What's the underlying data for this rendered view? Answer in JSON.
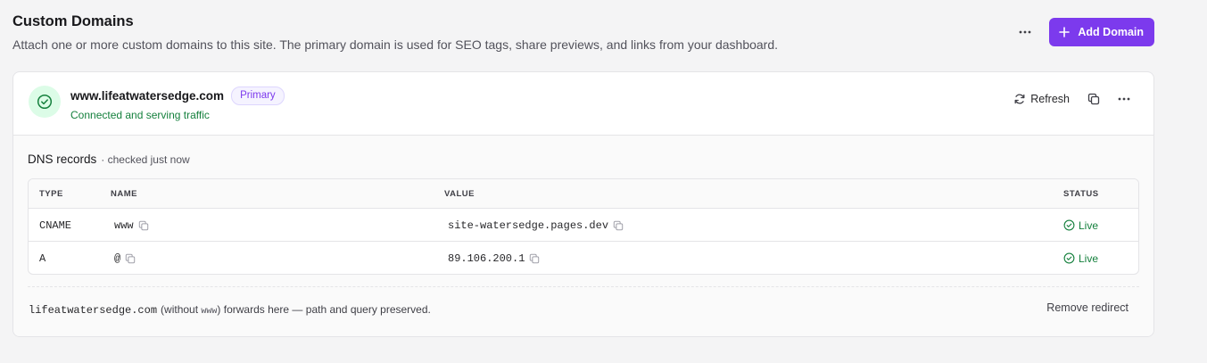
{
  "header": {
    "title": "Custom Domains",
    "description": "Attach one or more custom domains to this site. The primary domain is used for SEO tags, share previews, and links from your dashboard.",
    "more_icon": "more-horizontal-icon",
    "add_button_label": "Add Domain",
    "add_icon": "plus-icon"
  },
  "domain": {
    "name": "www.lifeatwatersedge.com",
    "badge": "Primary",
    "status_text": "Connected and serving traffic",
    "status_icon": "check-circle-icon",
    "refresh_label": "Refresh",
    "copy_icon": "copy-icon",
    "more_icon": "more-horizontal-icon"
  },
  "dns": {
    "title": "DNS records",
    "checked": "· checked just now",
    "columns": [
      "TYPE",
      "NAME",
      "VALUE",
      "STATUS"
    ],
    "rows": [
      {
        "type": "CNAME",
        "name": "www",
        "value": "site-watersedge.pages.dev",
        "status": "Live"
      },
      {
        "type": "A",
        "name": "@",
        "value": "89.106.200.1",
        "status": "Live"
      }
    ]
  },
  "redirect": {
    "domain": "lifeatwatersedge.com",
    "without_prefix": "(without ",
    "without_code": "www",
    "suffix": ") forwards here — path and query preserved.",
    "remove_label": "Remove redirect"
  },
  "colors": {
    "accent": "#7c3aed",
    "success": "#15803d",
    "success_bg": "#dcfce7"
  }
}
